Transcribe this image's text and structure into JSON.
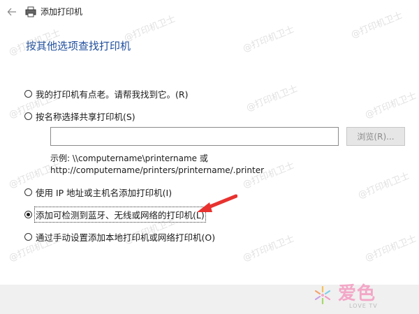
{
  "window": {
    "title": "添加打印机"
  },
  "heading": "按其他选项查找打印机",
  "options": [
    {
      "label": "我的打印机有点老。请帮我找到它。(R)",
      "checked": false
    },
    {
      "label": "按名称选择共享打印机(S)",
      "checked": false
    },
    {
      "label": "使用 IP 地址或主机名添加打印机(I)",
      "checked": false
    },
    {
      "label": "添加可检测到蓝牙、无线或网络的打印机(L)",
      "checked": true
    },
    {
      "label": "通过手动设置添加本地打印机或网络打印机(O)",
      "checked": false
    }
  ],
  "share_input": {
    "value": "",
    "placeholder": ""
  },
  "browse_label": "浏览(R)...",
  "example_line1": "示例: \\\\computername\\printername 或",
  "example_line2": "http://computername/printers/printername/.printer",
  "watermark_text": "@打印机卫士",
  "logo": {
    "text": "爱色",
    "sub": "LOVE TV"
  },
  "colors": {
    "heading": "#1f4e9c",
    "arrow": "#e8322f",
    "logo_pink": "#f3a7c7"
  },
  "icons": {
    "back": "back-arrow-icon",
    "printer": "printer-icon"
  }
}
